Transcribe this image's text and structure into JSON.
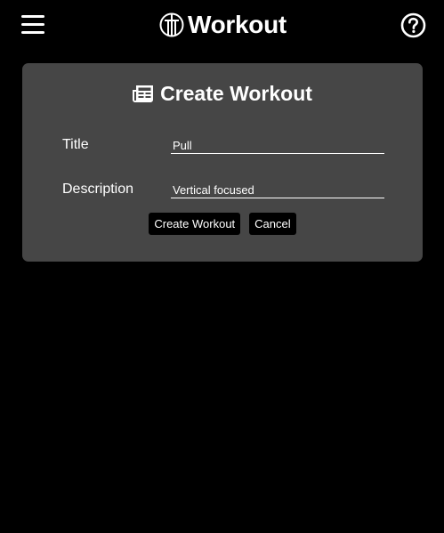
{
  "header": {
    "title": "Workout",
    "menu_icon": "hamburger-menu-icon",
    "logo_icon": "workout-logo-icon",
    "help_icon": "help-circle-icon"
  },
  "form": {
    "title": "Create Workout",
    "title_icon": "newspaper-icon",
    "fields": [
      {
        "label": "Title",
        "value": "Pull"
      },
      {
        "label": "Description",
        "value": "Vertical focused"
      }
    ],
    "submit_label": "Create Workout",
    "cancel_label": "Cancel"
  },
  "colors": {
    "background": "#000000",
    "card": "#464646",
    "text": "#ffffff",
    "button": "#000000"
  }
}
